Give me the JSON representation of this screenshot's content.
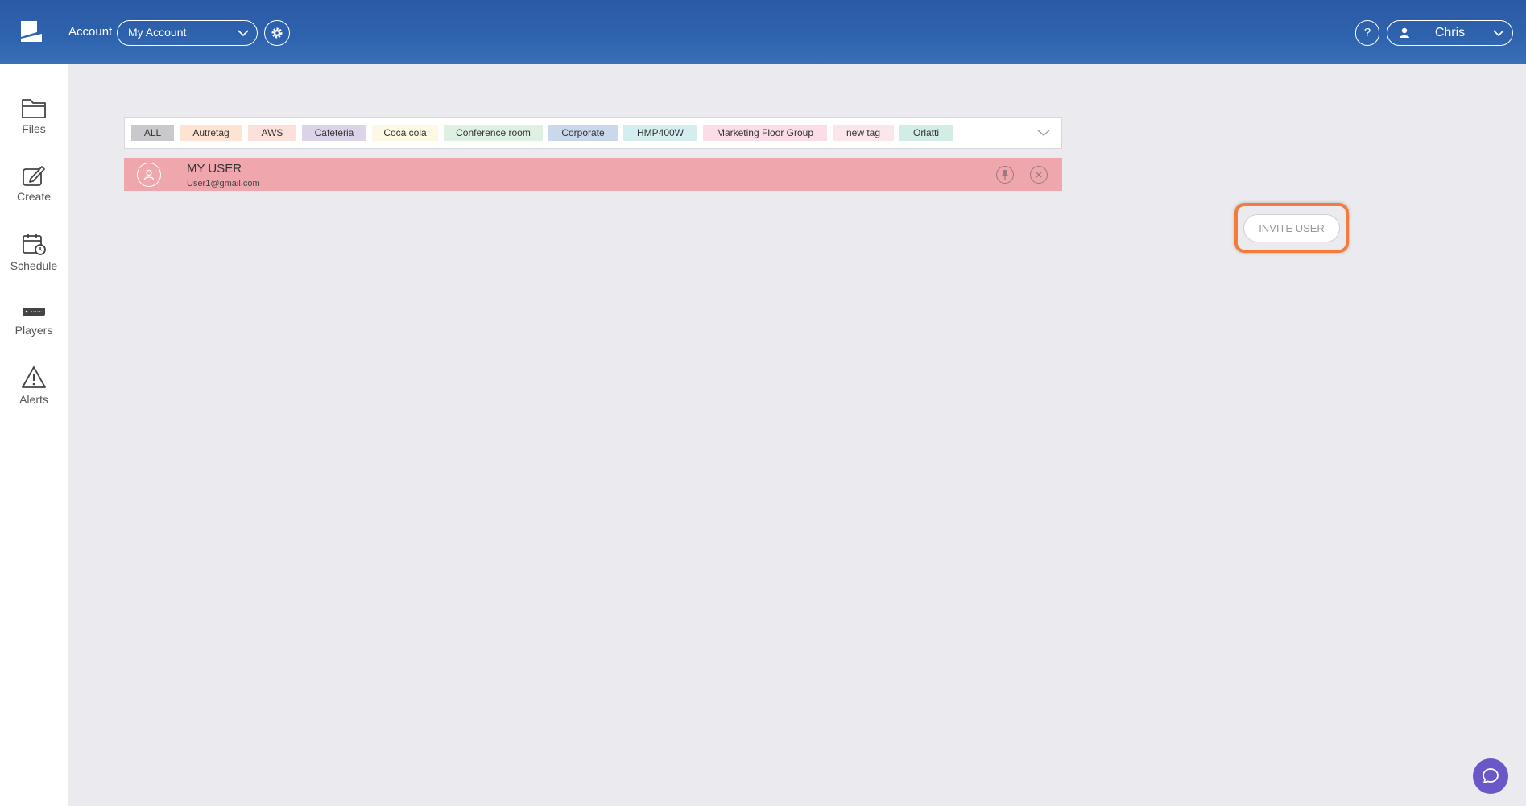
{
  "header": {
    "account_label": "Account",
    "account_select": "My Account",
    "help_label": "?",
    "user_name": "Chris"
  },
  "sidebar": {
    "items": [
      {
        "label": "Files",
        "icon": "folder-icon"
      },
      {
        "label": "Create",
        "icon": "edit-icon"
      },
      {
        "label": "Schedule",
        "icon": "calendar-clock-icon"
      },
      {
        "label": "Players",
        "icon": "player-device-icon"
      },
      {
        "label": "Alerts",
        "icon": "warning-icon"
      }
    ]
  },
  "tags": [
    {
      "label": "ALL",
      "color": "#c9c9cd"
    },
    {
      "label": "Autretag",
      "color": "#fde3d2"
    },
    {
      "label": "AWS",
      "color": "#fbe0dc"
    },
    {
      "label": "Cafeteria",
      "color": "#ddd3e8"
    },
    {
      "label": "Coca cola",
      "color": "#fcf8e3"
    },
    {
      "label": "Conference room",
      "color": "#def0e1"
    },
    {
      "label": "Corporate",
      "color": "#cbd7ea"
    },
    {
      "label": "HMP400W",
      "color": "#d4eef0"
    },
    {
      "label": "Marketing Floor Group",
      "color": "#fadde6"
    },
    {
      "label": "new tag",
      "color": "#fbe6ec"
    },
    {
      "label": "Orlatti",
      "color": "#d2ece6"
    }
  ],
  "user_row": {
    "name": "MY USER",
    "email": "User1@gmail.com",
    "color": "#efa6ad"
  },
  "invite": {
    "label": "INVITE USER",
    "highlight_color": "#f47b3a"
  }
}
